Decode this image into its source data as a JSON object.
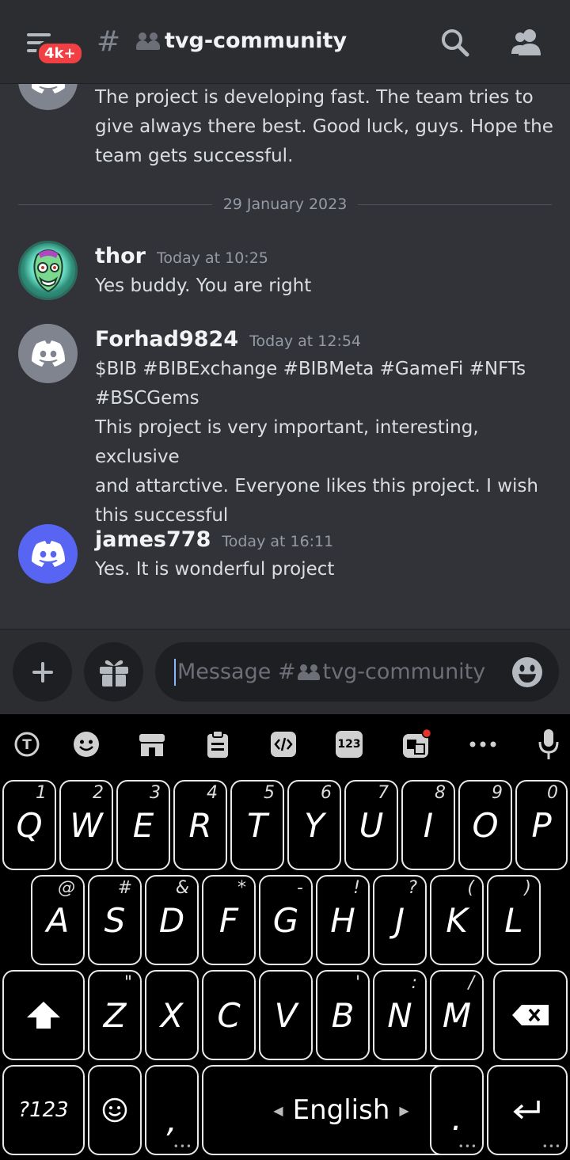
{
  "header": {
    "badge": "4k+",
    "hash": "#",
    "channel": "tvg-community"
  },
  "messages": [
    {
      "author": "",
      "timestamp": "",
      "lines": [
        "The project is developing fast. The team tries to",
        "give always there best. Good luck, guys. Hope the",
        "team gets successful."
      ]
    },
    {
      "author": "thor",
      "timestamp": "Today at 10:25",
      "lines": [
        "Yes buddy. You are right"
      ]
    },
    {
      "author": "Forhad9824",
      "timestamp": "Today at 12:54",
      "lines": [
        "$BIB #BIBExchange #BIBMeta #GameFi #NFTs",
        "#BSCGems",
        "This project is very important, interesting, exclusive",
        "and attarctive. Everyone likes this project. I wish",
        "this successful"
      ]
    },
    {
      "author": "james778",
      "timestamp": "Today at 16:11",
      "lines": [
        "Yes. It is wonderful project"
      ]
    }
  ],
  "date_divider": "29 January 2023",
  "composer": {
    "placeholder_prefix": "Message #",
    "placeholder_channel": "tvg-community"
  },
  "keyboard": {
    "toolbar": {
      "numbers_label": "123"
    },
    "row1": [
      {
        "key": "Q",
        "hint": "1"
      },
      {
        "key": "W",
        "hint": "2"
      },
      {
        "key": "E",
        "hint": "3"
      },
      {
        "key": "R",
        "hint": "4"
      },
      {
        "key": "T",
        "hint": "5"
      },
      {
        "key": "Y",
        "hint": "6"
      },
      {
        "key": "U",
        "hint": "7"
      },
      {
        "key": "I",
        "hint": "8"
      },
      {
        "key": "O",
        "hint": "9"
      },
      {
        "key": "P",
        "hint": "0"
      }
    ],
    "row2": [
      {
        "key": "A",
        "hint": "@"
      },
      {
        "key": "S",
        "hint": "#"
      },
      {
        "key": "D",
        "hint": "&"
      },
      {
        "key": "F",
        "hint": "*"
      },
      {
        "key": "G",
        "hint": "-"
      },
      {
        "key": "H",
        "hint": "!"
      },
      {
        "key": "J",
        "hint": "?"
      },
      {
        "key": "K",
        "hint": "("
      },
      {
        "key": "L",
        "hint": ")"
      }
    ],
    "row3": [
      {
        "key": "Z",
        "hint": "\""
      },
      {
        "key": "X",
        "hint": ""
      },
      {
        "key": "C",
        "hint": ""
      },
      {
        "key": "V",
        "hint": ""
      },
      {
        "key": "B",
        "hint": "'"
      },
      {
        "key": "N",
        "hint": ":"
      },
      {
        "key": "M",
        "hint": "/"
      }
    ],
    "symbols_label": "?123",
    "comma": ",",
    "space_label": "English",
    "period": "."
  }
}
